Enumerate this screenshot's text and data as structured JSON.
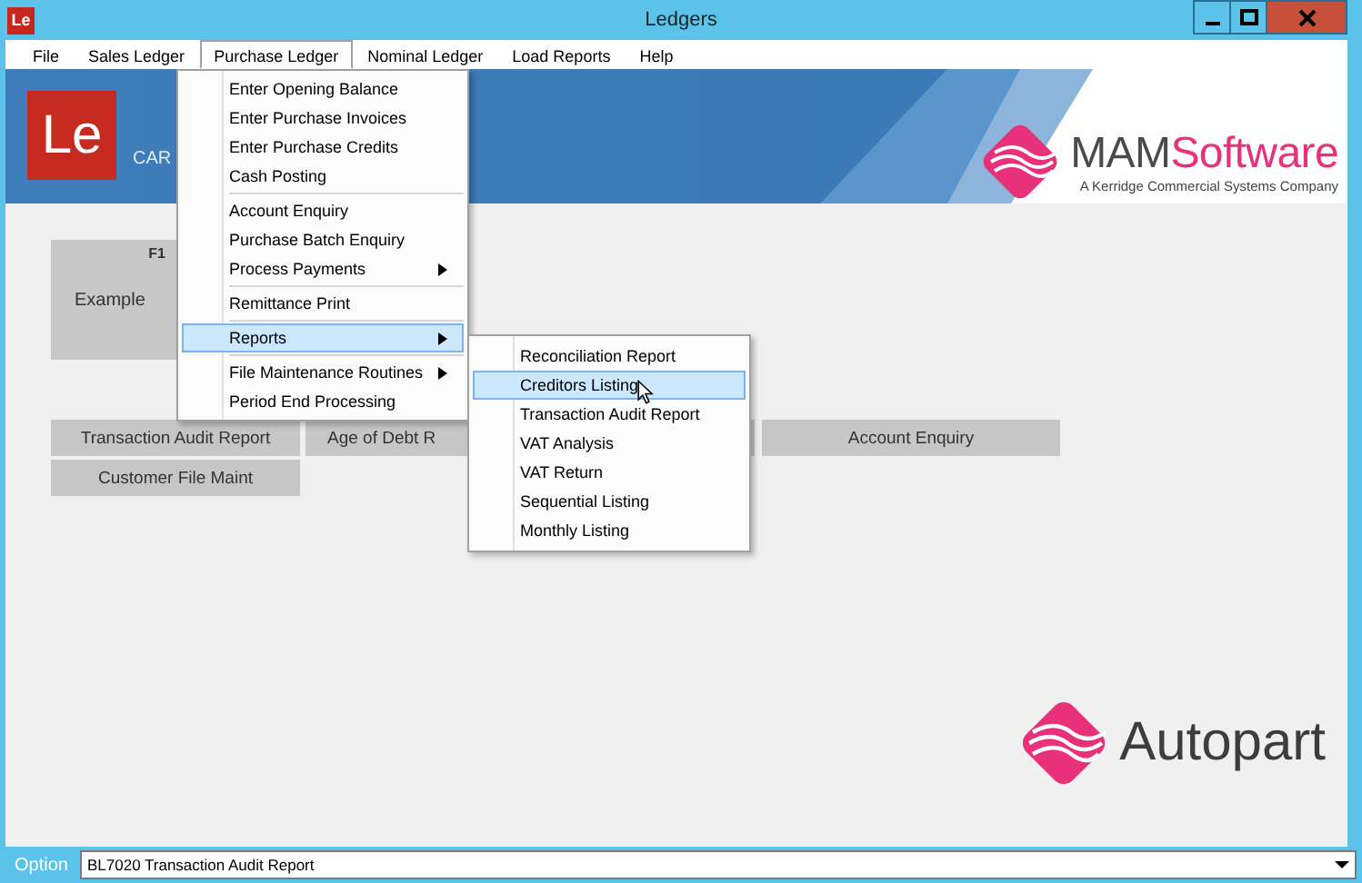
{
  "window": {
    "icon_text": "Le",
    "title": "Ledgers"
  },
  "menu_bar": [
    {
      "label": "File",
      "open": false
    },
    {
      "label": "Sales Ledger",
      "open": false
    },
    {
      "label": "Purchase Ledger",
      "open": true
    },
    {
      "label": "Nominal Ledger",
      "open": false
    },
    {
      "label": "Load Reports",
      "open": false
    },
    {
      "label": "Help",
      "open": false
    }
  ],
  "purchase_ledger_menu": [
    {
      "kind": "item",
      "label": "Enter Opening Balance",
      "selected": false,
      "submenu": false
    },
    {
      "kind": "item",
      "label": "Enter Purchase Invoices",
      "selected": false,
      "submenu": false
    },
    {
      "kind": "item",
      "label": "Enter Purchase Credits",
      "selected": false,
      "submenu": false
    },
    {
      "kind": "item",
      "label": "Cash Posting",
      "selected": false,
      "submenu": false
    },
    {
      "kind": "separator"
    },
    {
      "kind": "item",
      "label": "Account Enquiry",
      "selected": false,
      "submenu": false
    },
    {
      "kind": "item",
      "label": "Purchase Batch Enquiry",
      "selected": false,
      "submenu": false
    },
    {
      "kind": "item",
      "label": "Process Payments",
      "selected": false,
      "submenu": true
    },
    {
      "kind": "separator"
    },
    {
      "kind": "item",
      "label": "Remittance Print",
      "selected": false,
      "submenu": false
    },
    {
      "kind": "separator"
    },
    {
      "kind": "item",
      "label": "Reports",
      "selected": true,
      "submenu": true
    },
    {
      "kind": "separator"
    },
    {
      "kind": "item",
      "label": "File Maintenance Routines",
      "selected": false,
      "submenu": true
    },
    {
      "kind": "item",
      "label": "Period End Processing",
      "selected": false,
      "submenu": false
    }
  ],
  "reports_submenu": [
    {
      "label": "Reconciliation Report",
      "selected": false
    },
    {
      "label": "Creditors Listing",
      "selected": true
    },
    {
      "label": "Transaction Audit Report",
      "selected": false
    },
    {
      "label": "VAT Analysis",
      "selected": false
    },
    {
      "label": "VAT Return",
      "selected": false
    },
    {
      "label": "Sequential Listing",
      "selected": false
    },
    {
      "label": "Monthly Listing",
      "selected": false
    }
  ],
  "banner": {
    "logo_text": "Le",
    "caption": "CAR",
    "brand_prefix": "MAM",
    "brand_suffix": "Software",
    "tagline": "A Kerridge Commercial Systems Company"
  },
  "example_button": {
    "key": "F1",
    "label": "Example"
  },
  "button_rows": [
    [
      {
        "label": "Transaction Audit Report"
      },
      {
        "label": "Age of Debt R"
      },
      {
        "label": "Account Enquiry"
      }
    ],
    [
      {
        "label": "Customer File Maint"
      }
    ]
  ],
  "footer_logo": {
    "label": "Autopart"
  },
  "status_bar": {
    "label": "Option",
    "value": "BL7020  Transaction Audit Report"
  }
}
